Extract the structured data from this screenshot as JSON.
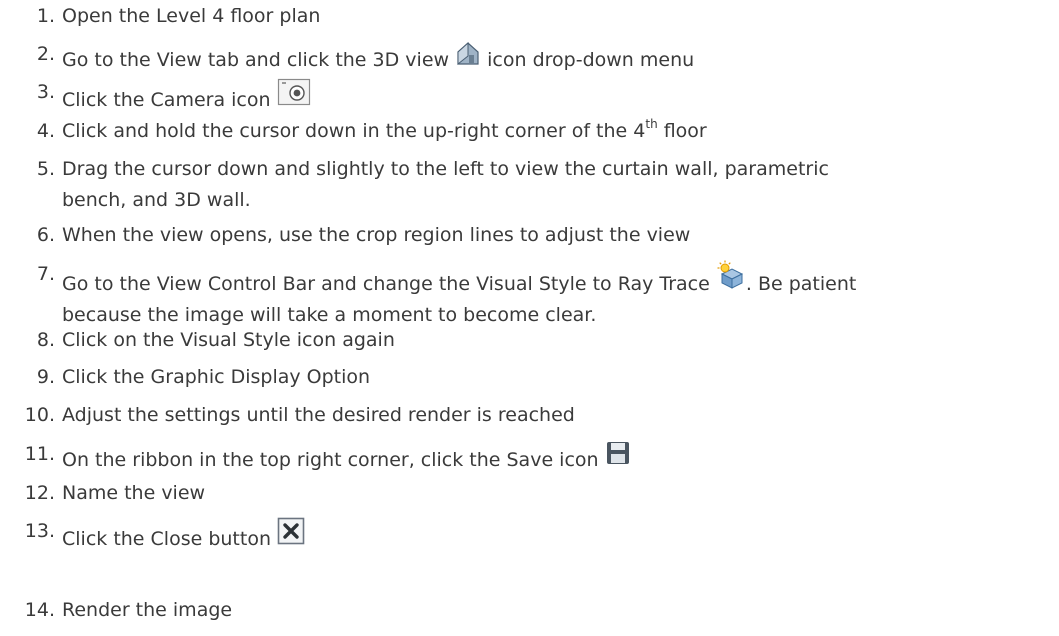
{
  "steps": [
    {
      "num": "1.",
      "text": "Open the Level 4 floor plan"
    },
    {
      "num": "2.",
      "text_a": "Go to the View tab and click the 3D view",
      "icon": "house-3d-icon",
      "text_b": "icon drop-down menu"
    },
    {
      "num": "3.",
      "text_a": "Click the Camera icon",
      "icon": "camera-icon"
    },
    {
      "num": "4.",
      "text_a": "Click and hold the cursor down in the up-right corner of the 4",
      "sup": "th",
      "text_b": "floor"
    },
    {
      "num": "5.",
      "line1": "Drag the cursor down and slightly to the left to view the curtain wall, parametric",
      "line2": "bench, and 3D wall."
    },
    {
      "num": "6.",
      "text": "When the view opens, use the crop region lines to adjust the view"
    },
    {
      "num": "7.",
      "text_a": "Go to the View Control Bar and change the Visual Style to Ray Trace",
      "icon": "ray-trace-icon",
      "text_b": ". Be patient",
      "line2": "because the image will take a moment to become clear."
    },
    {
      "num": "8.",
      "text": "Click on the Visual Style icon again"
    },
    {
      "num": "9.",
      "text": "Click the Graphic Display Option"
    },
    {
      "num": "10.",
      "text": "Adjust the settings until the desired render is reached"
    },
    {
      "num": "11.",
      "text_a": "On the ribbon in the top right corner, click the Save icon",
      "icon": "save-icon"
    },
    {
      "num": "12.",
      "text": "Name the view"
    },
    {
      "num": "13.",
      "text_a": "Click the Close button",
      "icon": "close-icon"
    },
    {
      "num": "14.",
      "text": "Render the image"
    }
  ]
}
